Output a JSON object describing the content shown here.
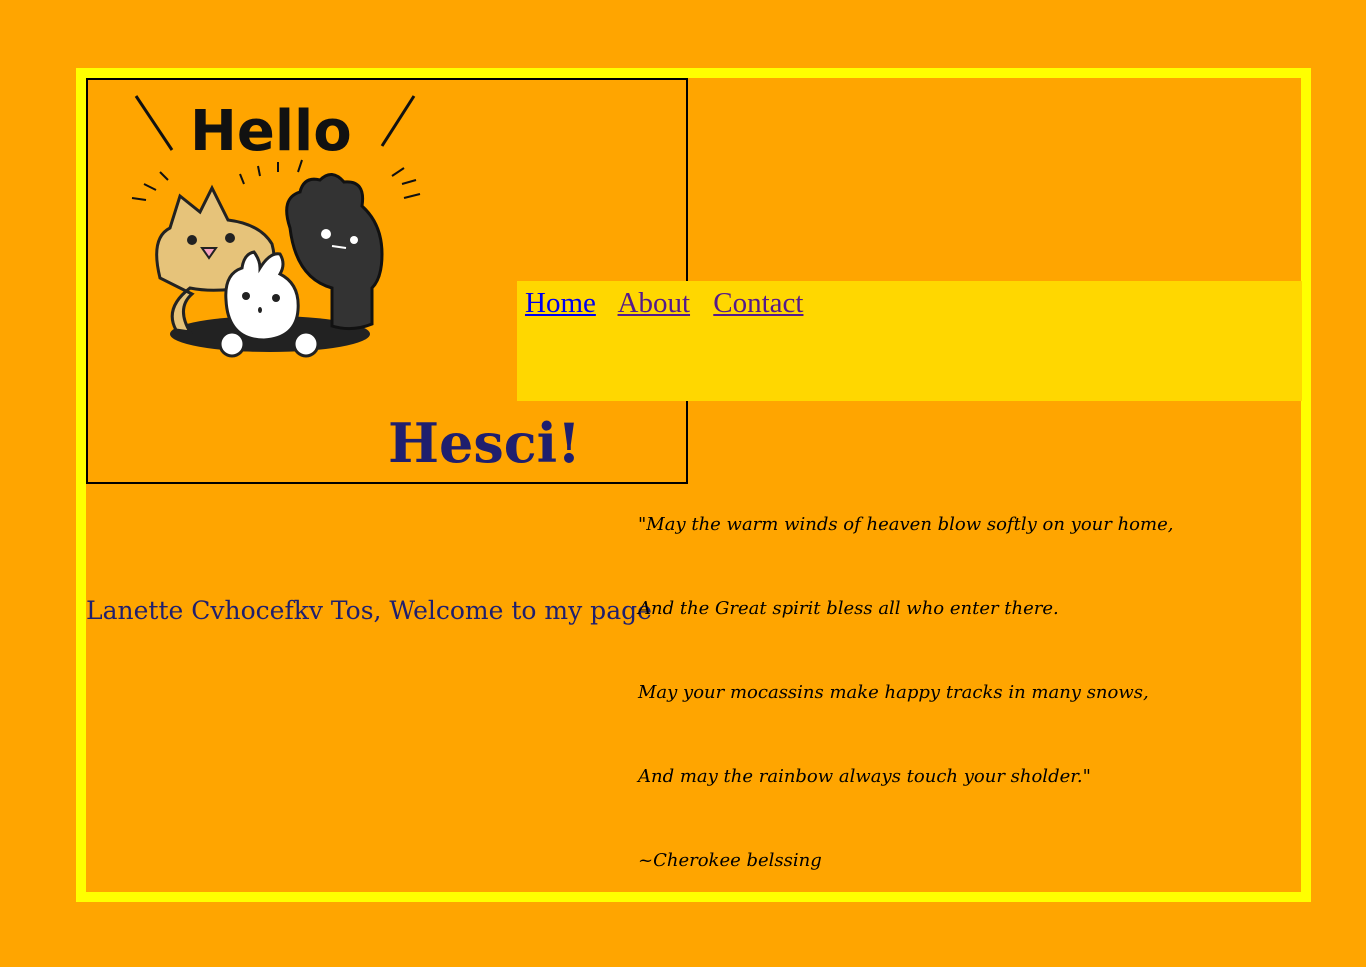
{
  "header": {
    "logo_text": "Hello",
    "title": "Hesci!"
  },
  "nav": {
    "items": [
      "Home",
      "About",
      "Contact"
    ]
  },
  "welcome": "Lanette Cvhocefkv Tos, Welcome to my page",
  "poem": {
    "lines": [
      "\"May the warm winds of heaven blow softly on your home,",
      "And the Great spirit bless all who enter there.",
      "May your mocassins make happy tracks in many snows,",
      "And may the rainbow always touch your sholder.\"",
      "~Cherokee belssing"
    ]
  },
  "colors": {
    "background": "#ffa500",
    "frame_border": "#ffff00",
    "nav_background": "#ffd700",
    "heading_text": "#1f1f6e"
  }
}
